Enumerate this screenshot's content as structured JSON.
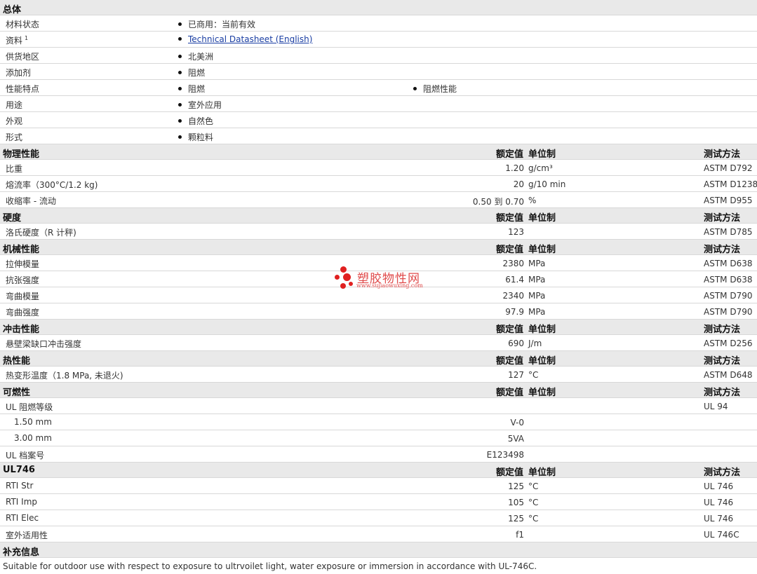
{
  "general": {
    "title": "总体",
    "rows": [
      {
        "label": "材料状态",
        "c1": "已商用：当前有效",
        "c2": ""
      },
      {
        "label": "资料",
        "sup": "1",
        "c1": "Technical Datasheet (English)",
        "c2": "",
        "link": true
      },
      {
        "label": "供货地区",
        "c1": "北美洲",
        "c2": ""
      },
      {
        "label": "添加剂",
        "c1": "阻燃",
        "c2": ""
      },
      {
        "label": "性能特点",
        "c1": "阻燃",
        "c2": "阻燃性能"
      },
      {
        "label": "用途",
        "c1": "室外应用",
        "c2": ""
      },
      {
        "label": "外观",
        "c1": "自然色",
        "c2": ""
      },
      {
        "label": "形式",
        "c1": "颗粒料",
        "c2": ""
      }
    ]
  },
  "headers": {
    "nominal": "额定值",
    "unit": "单位制",
    "method": "测试方法"
  },
  "sections": [
    {
      "title": "物理性能",
      "rows": [
        {
          "label": "比重",
          "value": "1.20",
          "unit": "g/cm³",
          "method": "ASTM D792"
        },
        {
          "label": "熔流率（300°C/1.2 kg)",
          "value": "20",
          "unit": "g/10 min",
          "method": "ASTM D1238"
        },
        {
          "label": "收缩率 - 流动",
          "value": "0.50 到  0.70",
          "unit": "%",
          "method": "ASTM D955"
        }
      ]
    },
    {
      "title": "硬度",
      "rows": [
        {
          "label": "洛氏硬度（R 计秤)",
          "value": "123",
          "unit": "",
          "method": "ASTM D785"
        }
      ]
    },
    {
      "title": "机械性能",
      "rows": [
        {
          "label": "拉伸模量",
          "value": "2380",
          "unit": "MPa",
          "method": "ASTM D638"
        },
        {
          "label": "抗张强度",
          "value": "61.4",
          "unit": "MPa",
          "method": "ASTM D638"
        },
        {
          "label": "弯曲模量",
          "value": "2340",
          "unit": "MPa",
          "method": "ASTM D790"
        },
        {
          "label": "弯曲强度",
          "value": "97.9",
          "unit": "MPa",
          "method": "ASTM D790"
        }
      ]
    },
    {
      "title": "冲击性能",
      "rows": [
        {
          "label": "悬壁梁缺口冲击强度",
          "value": "690",
          "unit": "J/m",
          "method": "ASTM D256"
        }
      ]
    },
    {
      "title": "热性能",
      "rows": [
        {
          "label": "热变形温度（1.8 MPa, 未退火)",
          "value": "127",
          "unit": "°C",
          "method": "ASTM D648"
        }
      ]
    },
    {
      "title": "可燃性",
      "rows": [
        {
          "label": "UL 阻燃等级",
          "value": "",
          "unit": "",
          "method": "UL 94"
        },
        {
          "label": "1.50 mm",
          "value": "V-0",
          "unit": "",
          "method": "",
          "sub": true
        },
        {
          "label": "3.00 mm",
          "value": "5VA",
          "unit": "",
          "method": "",
          "sub": true
        },
        {
          "label": "UL 档案号",
          "value": "E123498",
          "unit": "",
          "method": ""
        }
      ]
    },
    {
      "title": "UL746",
      "rows": [
        {
          "label": "RTI Str",
          "value": "125",
          "unit": "°C",
          "method": "UL 746"
        },
        {
          "label": "RTI Imp",
          "value": "105",
          "unit": "°C",
          "method": "UL 746"
        },
        {
          "label": "RTI Elec",
          "value": "125",
          "unit": "°C",
          "method": "UL 746"
        },
        {
          "label": "室外适用性",
          "value": "f1",
          "unit": "",
          "method": "UL 746C"
        }
      ]
    }
  ],
  "notes": {
    "title": "补充信息",
    "text": "Suitable for outdoor use with respect to exposure to ultrvoilet light, water exposure or immersion in accordance with UL-746C."
  },
  "watermark": {
    "text": "塑胶物性网",
    "url": "www.sujiaowuxing.com",
    "color": "#e02020"
  }
}
